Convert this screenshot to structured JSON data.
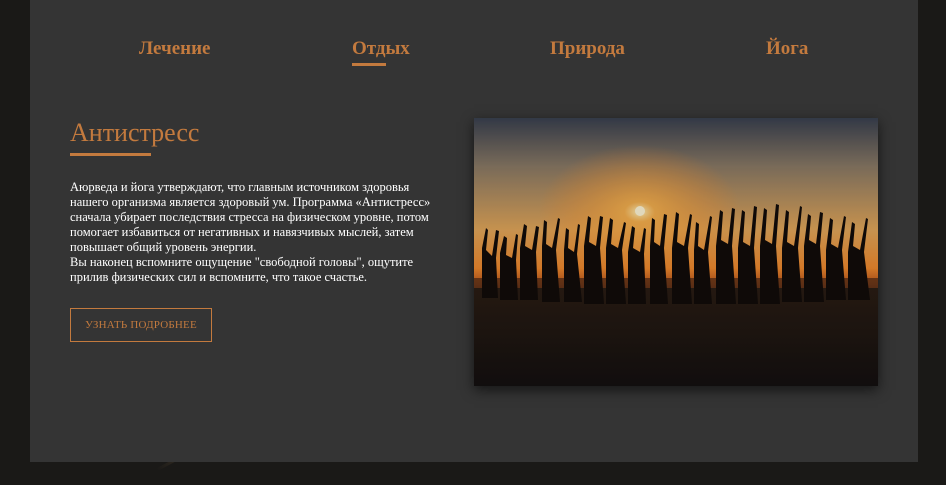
{
  "tabs": [
    {
      "label": "Лечение"
    },
    {
      "label": "Отдых"
    },
    {
      "label": "Природа"
    },
    {
      "label": "Йога"
    }
  ],
  "active_tab": "Отдых",
  "section": {
    "title": "Антистресс",
    "paragraph1": "Аюрведа и йога утверждают, что главным источником здоровья нашего организма является здоровый ум. Программа «Антистресс» сначала убирает последствия стресса на физическом уровне, потом помогает избавиться от негативных и навязчивых мыслей, затем повышает общий уровень энергии.",
    "paragraph2": "Вы наконец вспомните ощущение \"свободной головы\", ощутите прилив физических сил и вспомните, что такое счастье.",
    "button_label": "УЗНАТЬ ПОДРОБНЕЕ"
  },
  "colors": {
    "accent": "#c37a3e",
    "panel_bg": "#343434",
    "page_bg": "#1a1917",
    "text": "#ffffff"
  }
}
